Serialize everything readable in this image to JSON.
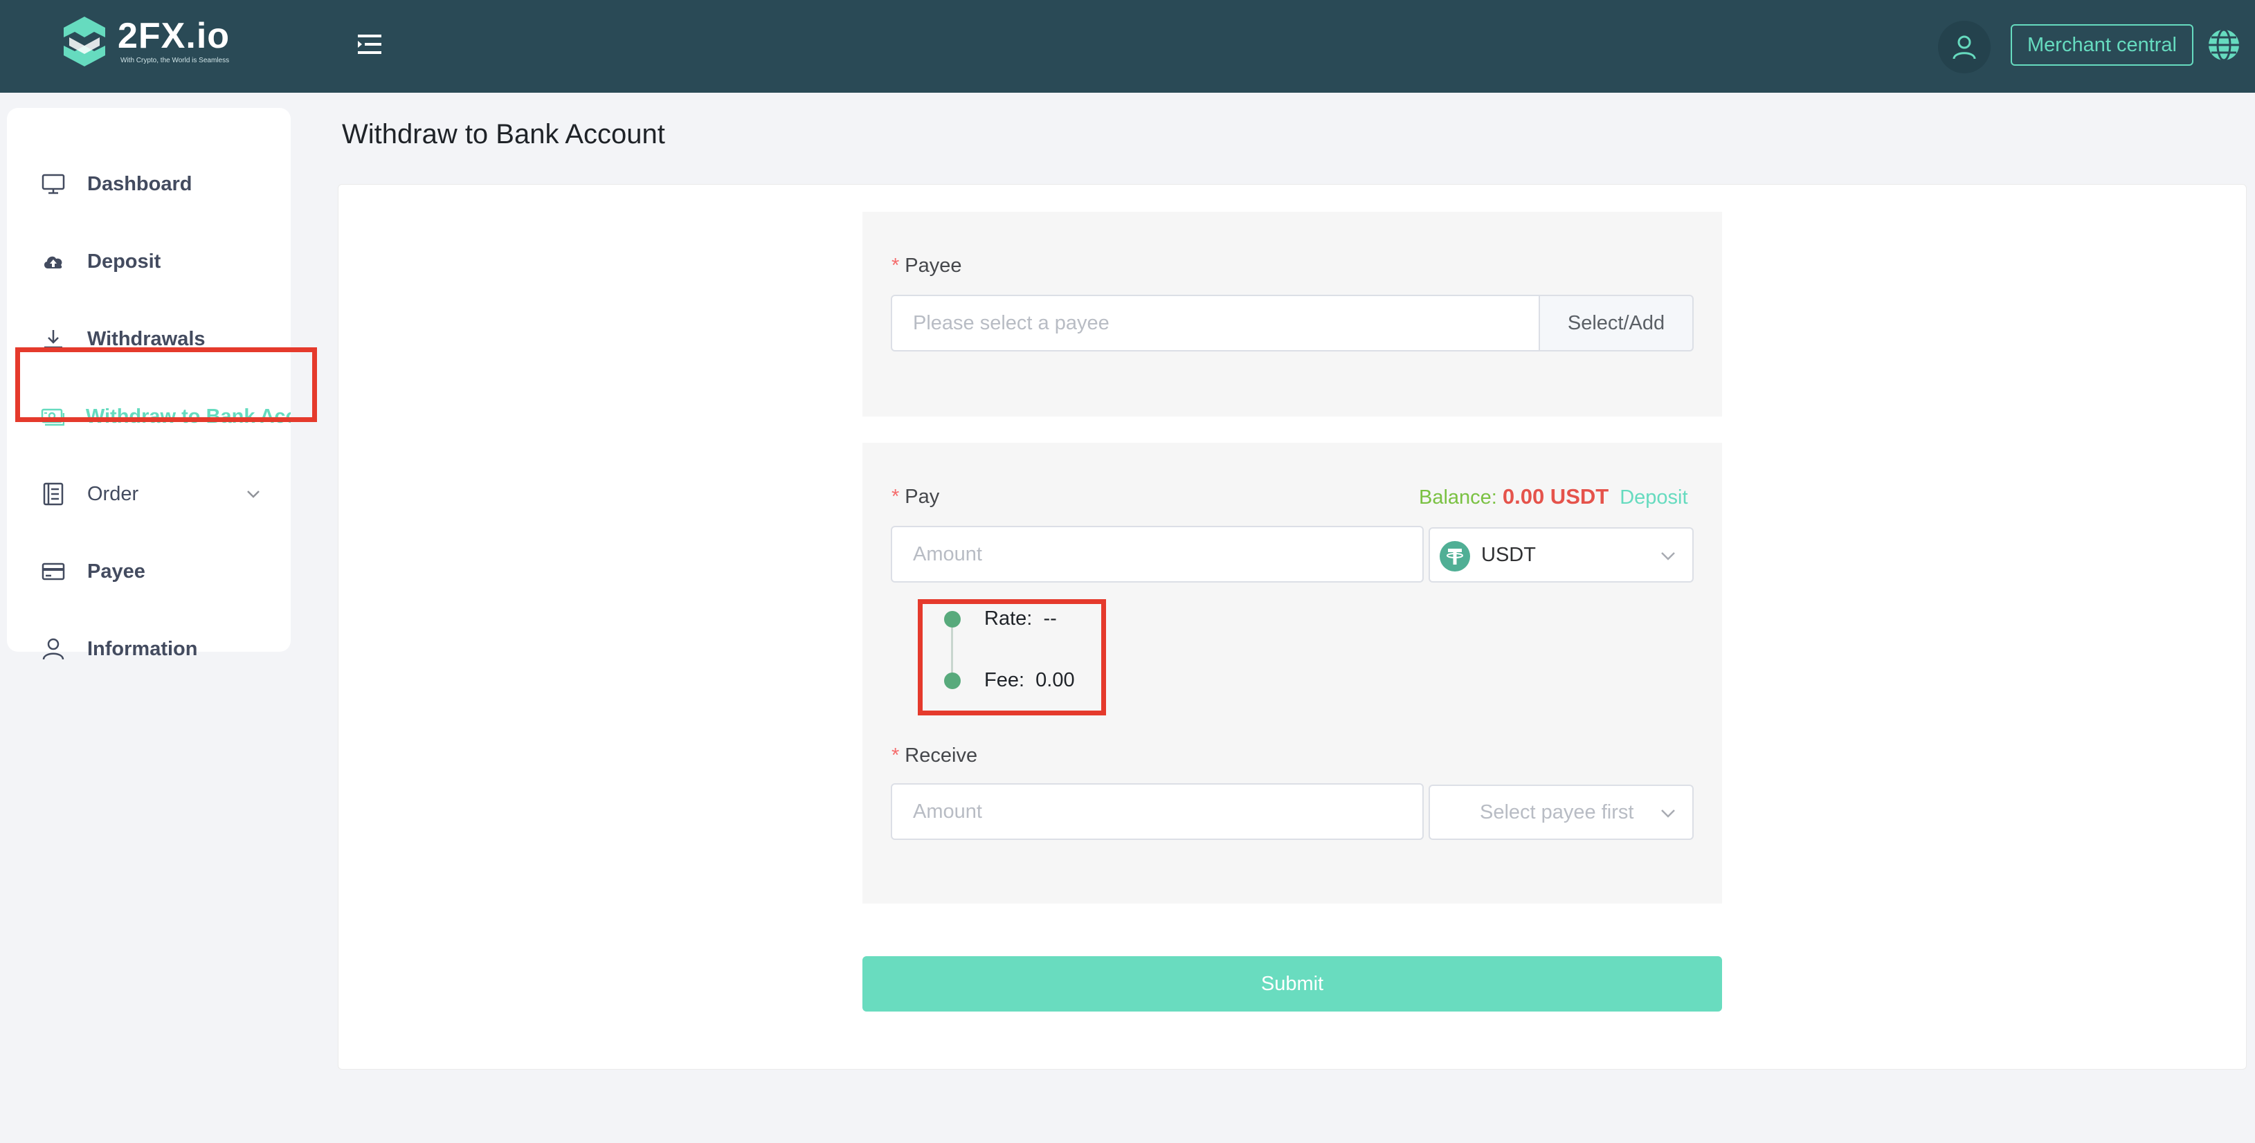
{
  "brand": {
    "name": "2FX.io",
    "tagline": "With Crypto, the World is Seamless"
  },
  "header": {
    "merchant_label": "Merchant central"
  },
  "sidebar": {
    "items": [
      {
        "label": "Dashboard",
        "icon": "monitor-icon"
      },
      {
        "label": "Deposit",
        "icon": "cloud-upload-icon"
      },
      {
        "label": "Withdrawals",
        "icon": "download-icon"
      },
      {
        "label": "Withdraw to Bank Account",
        "icon": "banknote-icon",
        "active": true
      },
      {
        "label": "Order",
        "icon": "document-list-icon",
        "expandable": true
      },
      {
        "label": "Payee",
        "icon": "credit-card-icon"
      },
      {
        "label": "Information",
        "icon": "user-icon"
      }
    ]
  },
  "page": {
    "title": "Withdraw to Bank Account"
  },
  "form": {
    "payee": {
      "label": "Payee",
      "placeholder": "Please select a payee",
      "button": "Select/Add"
    },
    "pay": {
      "label": "Pay",
      "balance_label": "Balance:",
      "balance_value": "0.00 USDT",
      "deposit_link": "Deposit",
      "amount_placeholder": "Amount",
      "currency": "USDT"
    },
    "rate": {
      "rate_label": "Rate:",
      "rate_value": "--",
      "fee_label": "Fee:",
      "fee_value": "0.00"
    },
    "receive": {
      "label": "Receive",
      "amount_placeholder": "Amount",
      "currency_placeholder": "Select payee first"
    },
    "submit_label": "Submit"
  },
  "colors": {
    "header_bg": "#2a4a56",
    "accent": "#66dbbf",
    "highlight": "#e53a2c",
    "balance_label": "#7ac142",
    "balance_value": "#e5534b"
  }
}
